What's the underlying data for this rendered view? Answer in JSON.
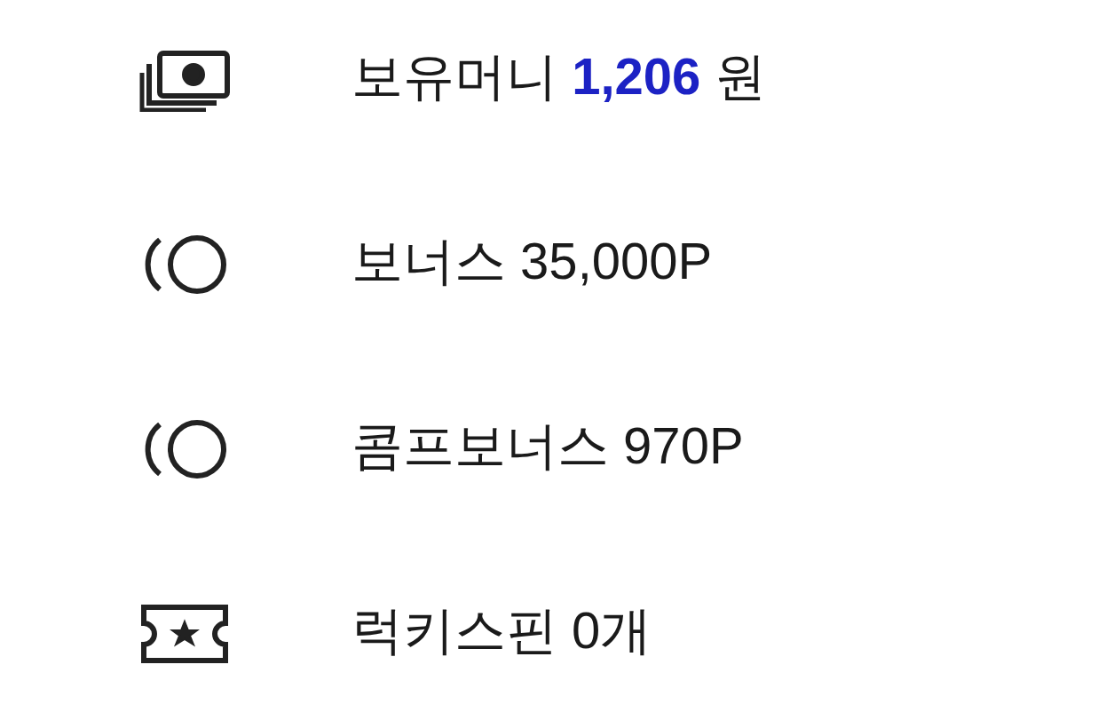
{
  "items": [
    {
      "kind": "money",
      "label": "보유머니",
      "amount": "1,206",
      "unit": "원"
    },
    {
      "kind": "coin",
      "label": "보너스 35,000P"
    },
    {
      "kind": "coin",
      "label": "콤프보너스 970P"
    },
    {
      "kind": "ticket",
      "label": "럭키스핀 0개"
    }
  ]
}
